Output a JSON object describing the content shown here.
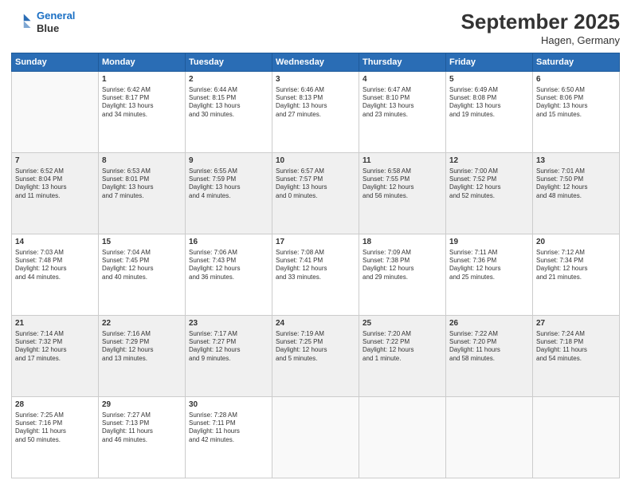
{
  "header": {
    "logo_line1": "General",
    "logo_line2": "Blue",
    "month_year": "September 2025",
    "location": "Hagen, Germany"
  },
  "weekdays": [
    "Sunday",
    "Monday",
    "Tuesday",
    "Wednesday",
    "Thursday",
    "Friday",
    "Saturday"
  ],
  "weeks": [
    [
      {
        "day": "",
        "info": ""
      },
      {
        "day": "1",
        "info": "Sunrise: 6:42 AM\nSunset: 8:17 PM\nDaylight: 13 hours\nand 34 minutes."
      },
      {
        "day": "2",
        "info": "Sunrise: 6:44 AM\nSunset: 8:15 PM\nDaylight: 13 hours\nand 30 minutes."
      },
      {
        "day": "3",
        "info": "Sunrise: 6:46 AM\nSunset: 8:13 PM\nDaylight: 13 hours\nand 27 minutes."
      },
      {
        "day": "4",
        "info": "Sunrise: 6:47 AM\nSunset: 8:10 PM\nDaylight: 13 hours\nand 23 minutes."
      },
      {
        "day": "5",
        "info": "Sunrise: 6:49 AM\nSunset: 8:08 PM\nDaylight: 13 hours\nand 19 minutes."
      },
      {
        "day": "6",
        "info": "Sunrise: 6:50 AM\nSunset: 8:06 PM\nDaylight: 13 hours\nand 15 minutes."
      }
    ],
    [
      {
        "day": "7",
        "info": "Sunrise: 6:52 AM\nSunset: 8:04 PM\nDaylight: 13 hours\nand 11 minutes."
      },
      {
        "day": "8",
        "info": "Sunrise: 6:53 AM\nSunset: 8:01 PM\nDaylight: 13 hours\nand 7 minutes."
      },
      {
        "day": "9",
        "info": "Sunrise: 6:55 AM\nSunset: 7:59 PM\nDaylight: 13 hours\nand 4 minutes."
      },
      {
        "day": "10",
        "info": "Sunrise: 6:57 AM\nSunset: 7:57 PM\nDaylight: 13 hours\nand 0 minutes."
      },
      {
        "day": "11",
        "info": "Sunrise: 6:58 AM\nSunset: 7:55 PM\nDaylight: 12 hours\nand 56 minutes."
      },
      {
        "day": "12",
        "info": "Sunrise: 7:00 AM\nSunset: 7:52 PM\nDaylight: 12 hours\nand 52 minutes."
      },
      {
        "day": "13",
        "info": "Sunrise: 7:01 AM\nSunset: 7:50 PM\nDaylight: 12 hours\nand 48 minutes."
      }
    ],
    [
      {
        "day": "14",
        "info": "Sunrise: 7:03 AM\nSunset: 7:48 PM\nDaylight: 12 hours\nand 44 minutes."
      },
      {
        "day": "15",
        "info": "Sunrise: 7:04 AM\nSunset: 7:45 PM\nDaylight: 12 hours\nand 40 minutes."
      },
      {
        "day": "16",
        "info": "Sunrise: 7:06 AM\nSunset: 7:43 PM\nDaylight: 12 hours\nand 36 minutes."
      },
      {
        "day": "17",
        "info": "Sunrise: 7:08 AM\nSunset: 7:41 PM\nDaylight: 12 hours\nand 33 minutes."
      },
      {
        "day": "18",
        "info": "Sunrise: 7:09 AM\nSunset: 7:38 PM\nDaylight: 12 hours\nand 29 minutes."
      },
      {
        "day": "19",
        "info": "Sunrise: 7:11 AM\nSunset: 7:36 PM\nDaylight: 12 hours\nand 25 minutes."
      },
      {
        "day": "20",
        "info": "Sunrise: 7:12 AM\nSunset: 7:34 PM\nDaylight: 12 hours\nand 21 minutes."
      }
    ],
    [
      {
        "day": "21",
        "info": "Sunrise: 7:14 AM\nSunset: 7:32 PM\nDaylight: 12 hours\nand 17 minutes."
      },
      {
        "day": "22",
        "info": "Sunrise: 7:16 AM\nSunset: 7:29 PM\nDaylight: 12 hours\nand 13 minutes."
      },
      {
        "day": "23",
        "info": "Sunrise: 7:17 AM\nSunset: 7:27 PM\nDaylight: 12 hours\nand 9 minutes."
      },
      {
        "day": "24",
        "info": "Sunrise: 7:19 AM\nSunset: 7:25 PM\nDaylight: 12 hours\nand 5 minutes."
      },
      {
        "day": "25",
        "info": "Sunrise: 7:20 AM\nSunset: 7:22 PM\nDaylight: 12 hours\nand 1 minute."
      },
      {
        "day": "26",
        "info": "Sunrise: 7:22 AM\nSunset: 7:20 PM\nDaylight: 11 hours\nand 58 minutes."
      },
      {
        "day": "27",
        "info": "Sunrise: 7:24 AM\nSunset: 7:18 PM\nDaylight: 11 hours\nand 54 minutes."
      }
    ],
    [
      {
        "day": "28",
        "info": "Sunrise: 7:25 AM\nSunset: 7:16 PM\nDaylight: 11 hours\nand 50 minutes."
      },
      {
        "day": "29",
        "info": "Sunrise: 7:27 AM\nSunset: 7:13 PM\nDaylight: 11 hours\nand 46 minutes."
      },
      {
        "day": "30",
        "info": "Sunrise: 7:28 AM\nSunset: 7:11 PM\nDaylight: 11 hours\nand 42 minutes."
      },
      {
        "day": "",
        "info": ""
      },
      {
        "day": "",
        "info": ""
      },
      {
        "day": "",
        "info": ""
      },
      {
        "day": "",
        "info": ""
      }
    ]
  ]
}
